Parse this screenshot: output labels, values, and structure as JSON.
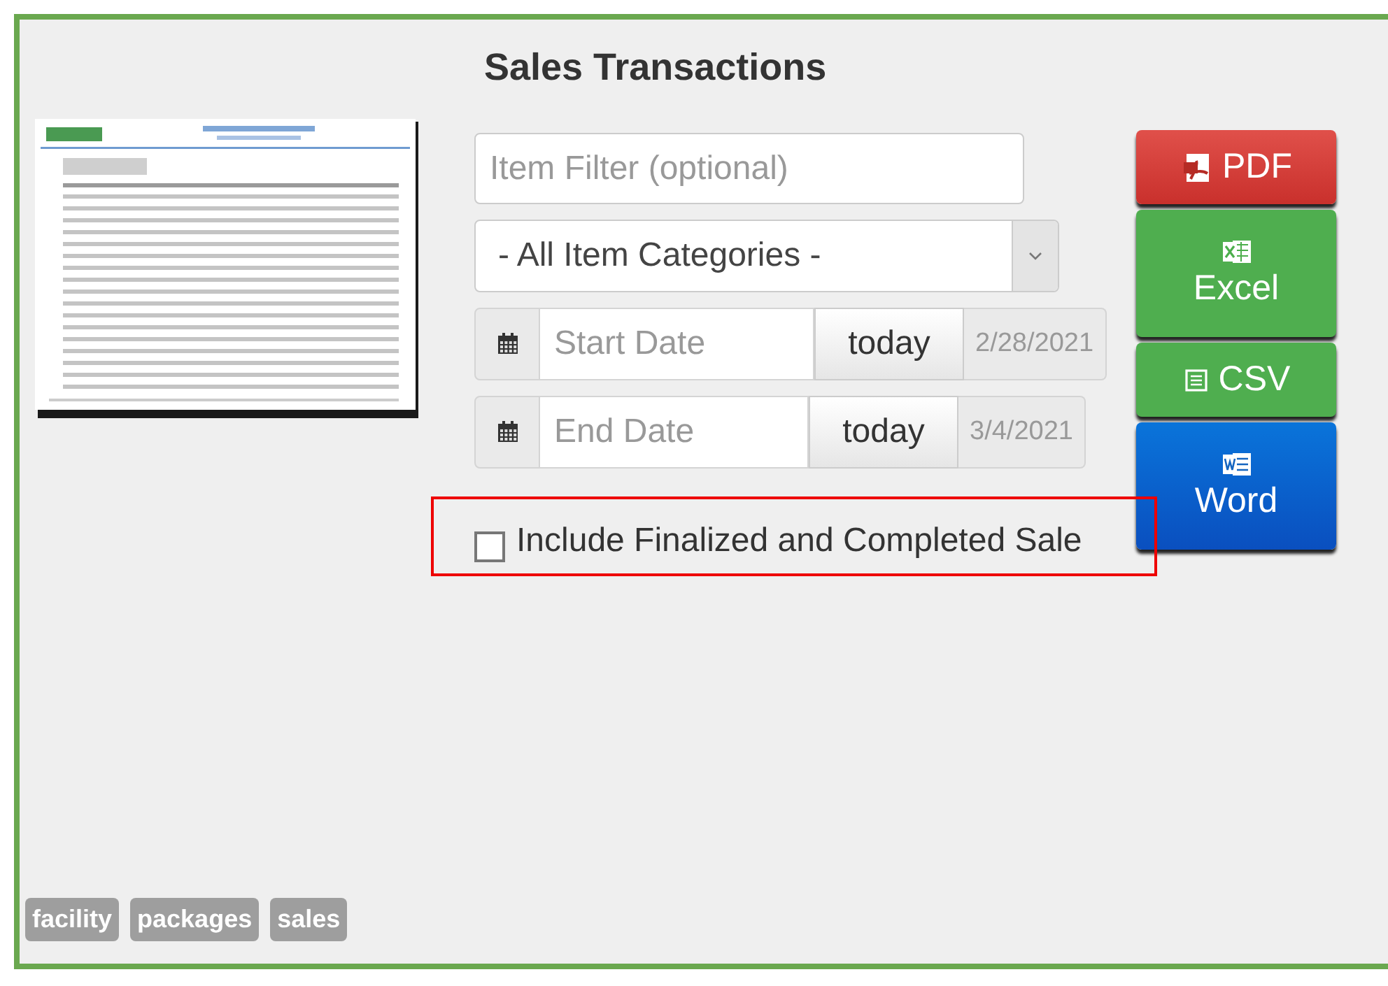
{
  "title": "Sales Transactions",
  "preview": {
    "kind": "picture"
  },
  "item_filter": {
    "placeholder": "Item Filter (optional)"
  },
  "category_select": {
    "value": "- All Item Categories -"
  },
  "date_ranges": [
    {
      "placeholder": "Start Date",
      "button": "today",
      "hint": "2/28/2021"
    },
    {
      "placeholder": "End Date",
      "button": "today",
      "hint": "3/4/2021"
    }
  ],
  "include_finalized": {
    "label": "Include Finalized and Completed Sale",
    "checked": false,
    "highlighted": true
  },
  "export_buttons": [
    {
      "kind": "pdf",
      "label": "PDF"
    },
    {
      "kind": "excel",
      "label": "Excel"
    },
    {
      "kind": "csv",
      "label": "CSV"
    },
    {
      "kind": "word",
      "label": "Word"
    }
  ],
  "tags": [
    "facility",
    "packages",
    "sales"
  ]
}
